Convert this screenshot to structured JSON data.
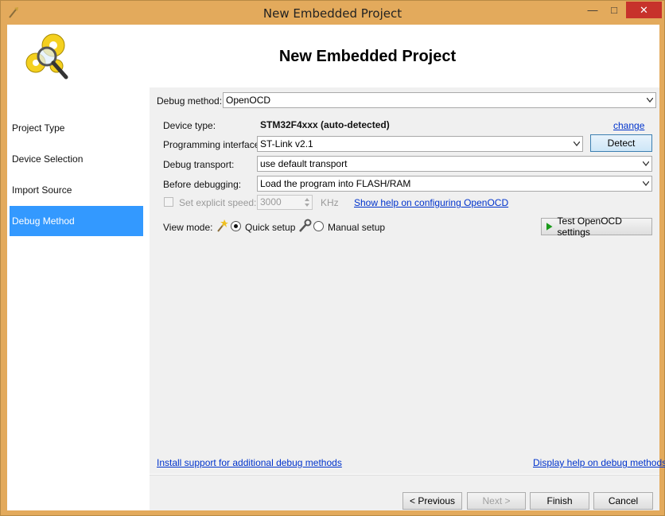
{
  "window": {
    "title": "New Embedded Project",
    "min_glyph": "—",
    "max_glyph": "□",
    "close_glyph": "✕"
  },
  "header": {
    "title": "New Embedded Project"
  },
  "sidebar": {
    "items": [
      {
        "label": "Project Type"
      },
      {
        "label": "Device Selection"
      },
      {
        "label": "Import Source"
      },
      {
        "label": "Debug Method"
      }
    ],
    "active_index": 3
  },
  "debug": {
    "method_label": "Debug method:",
    "method_value": "OpenOCD",
    "device_type_label": "Device type:",
    "device_type_value": "STM32F4xxx (auto-detected)",
    "change_link": "change",
    "prog_iface_label": "Programming interface:",
    "prog_iface_value": "ST-Link v2.1",
    "detect_button": "Detect",
    "transport_label": "Debug transport:",
    "transport_value": "use default transport",
    "before_label": "Before debugging:",
    "before_value": "Load the program into FLASH/RAM",
    "speed_label": "Set explicit speed:",
    "speed_value": "3000",
    "speed_unit": "KHz",
    "help_link": "Show help on configuring OpenOCD",
    "view_mode_label": "View mode:",
    "quick_setup": "Quick setup",
    "manual_setup": "Manual setup",
    "test_button": "Test OpenOCD settings"
  },
  "footer_links": {
    "install": "Install support for additional debug methods",
    "display_help": "Display help on debug methods"
  },
  "wizard_buttons": {
    "previous": "< Previous",
    "next": "Next >",
    "finish": "Finish",
    "cancel": "Cancel"
  },
  "colors": {
    "accent": "#3399ff",
    "frame": "#e3aa5c",
    "link": "#0033cc",
    "close": "#c7322b"
  }
}
